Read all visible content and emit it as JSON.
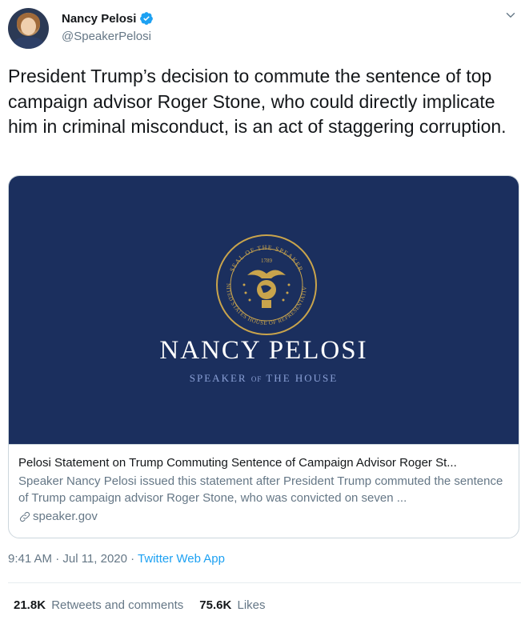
{
  "user": {
    "display_name": "Nancy Pelosi",
    "handle": "@SpeakerPelosi",
    "verified": true
  },
  "tweet": {
    "text": "President Trump’s decision to commute the sentence of top campaign advisor Roger Stone, who could directly implicate him in criminal misconduct, is an act of staggering corruption."
  },
  "card": {
    "image_title": "NANCY PELOSI",
    "image_subtitle_a": "SPEAKER",
    "image_subtitle_of": "OF",
    "image_subtitle_b": "THE HOUSE",
    "seal_year": "1789",
    "seal_text_top": "SEAL OF THE SPEAKER",
    "seal_text_bottom": "UNITED STATES HOUSE OF REPRESENTATIVES",
    "headline": "Pelosi Statement on Trump Commuting Sentence of Campaign Advisor Roger St...",
    "description": "Speaker Nancy Pelosi issued this statement after President Trump commuted the sentence of Trump campaign advisor Roger Stone, who was convicted on seven ...",
    "domain": "speaker.gov"
  },
  "meta": {
    "time": "9:41 AM · Jul 11, 2020 · ",
    "app": "Twitter Web App"
  },
  "stats": {
    "retweets_count": "21.8K",
    "retweets_label": "Retweets and comments",
    "likes_count": "75.6K",
    "likes_label": "Likes"
  },
  "colors": {
    "link_blue": "#1da1f2",
    "card_navy": "#1b2f5e",
    "seal_gold": "#c9a44c",
    "secondary_text": "#657786"
  },
  "icons": [
    "verified-badge-icon",
    "chevron-down-icon",
    "link-icon"
  ]
}
